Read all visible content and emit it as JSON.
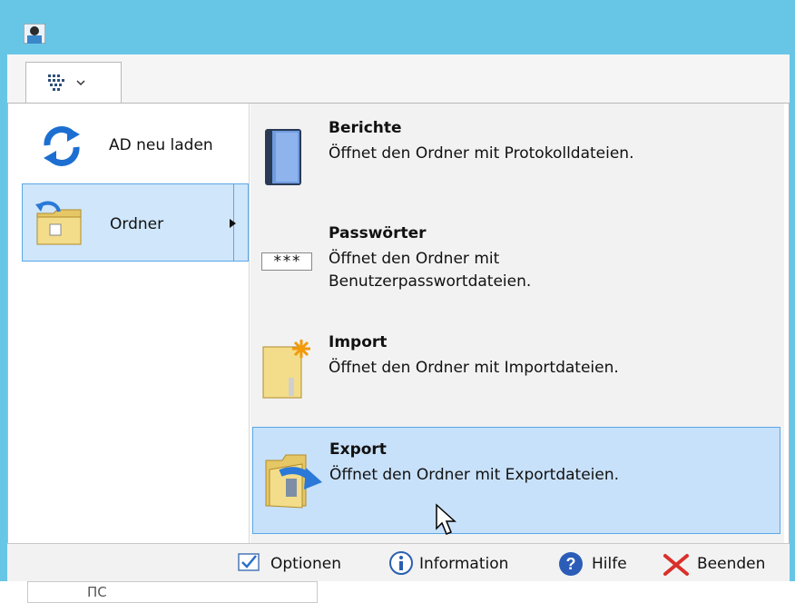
{
  "colors": {
    "titlebar": "#67c6e6",
    "selected_bg": "#cfe6fb",
    "hover_bg": "#c8e1fa",
    "selected_border": "#5aa7e8",
    "close_x": "#d9302a"
  },
  "icons": {
    "app": "app-user-icon",
    "menu": "grid-menu-icon",
    "reload": "refresh-arrows-icon",
    "folder": "folder-open-icon"
  },
  "left_menu": [
    {
      "label": "AD neu laden",
      "icon": "refresh-arrows-icon"
    },
    {
      "label": "Ordner",
      "icon": "folder-icon",
      "selected": true
    }
  ],
  "submenu": [
    {
      "title": "Berichte",
      "desc": "Öffnet den Ordner mit Protokolldateien.",
      "icon": "book-icon"
    },
    {
      "title": "Passwörter",
      "desc": "Öffnet den Ordner mit Benutzerpasswortdateien.",
      "icon": "password-icon",
      "password_glyph": "***"
    },
    {
      "title": "Import",
      "desc": "Öffnet den Ordner mit Importdateien.",
      "icon": "import-file-icon"
    },
    {
      "title": "Export",
      "desc": "Öffnet den Ordner mit Exportdateien.",
      "icon": "export-folder-icon",
      "hovered": true
    }
  ],
  "statusbar": {
    "options": "Optionen",
    "information": "Information",
    "help": "Hilfe",
    "quit": "Beenden"
  },
  "behind_text": "ПС"
}
